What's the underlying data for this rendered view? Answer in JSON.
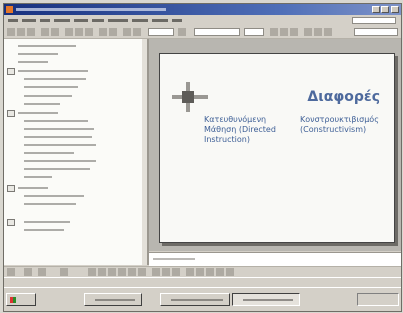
{
  "slide": {
    "title": "Διαφορές",
    "left_column": "Κατευθυνόμενη Μάθηση (Directed Instruction)",
    "right_column": "Κονστρουκτιβισμός (Constructivism)"
  },
  "colors": {
    "title_bar": "#17307e",
    "slide_text": "#3e5f96",
    "slide_background": "#f9f9f6",
    "window_chrome": "#d4d0c8"
  },
  "icons": [
    "app-icon",
    "minimize-icon",
    "maximize-icon",
    "close-icon",
    "windows-flag-icon"
  ]
}
